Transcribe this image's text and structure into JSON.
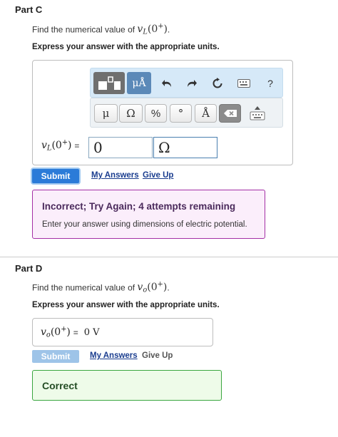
{
  "part_c": {
    "title": "Part C",
    "prompt": "Find the numerical value of",
    "var": "v",
    "var_sub": "L",
    "arg_open": "(0",
    "arg_sup": "+",
    "arg_close": ")",
    "period": ".",
    "instruction": "Express your answer with the appropriate units.",
    "toolbar": {
      "template_icon": "template-icon",
      "units_label": "μÅ",
      "undo_icon": "undo-icon",
      "redo_icon": "redo-icon",
      "reset_icon": "reset-icon",
      "keyboard_icon": "keyboard-icon",
      "help_label": "?"
    },
    "keys": [
      "μ",
      "Ω",
      "%",
      "°",
      "Å"
    ],
    "delete_icon": "backspace-icon",
    "keyboard_toggle_icon": "keyboard-toggle-icon",
    "label_equals": "=",
    "value_input": "0",
    "units_input": "Ω",
    "submit_label": "Submit",
    "my_answers": "My Answers",
    "give_up": "Give Up",
    "feedback_title": "Incorrect; Try Again; 4 attempts remaining",
    "feedback_body": "Enter your answer using dimensions of electric potential."
  },
  "part_d": {
    "title": "Part D",
    "prompt": "Find the numerical value of",
    "var": "v",
    "var_sub": "o",
    "arg_open": "(0",
    "arg_sup": "+",
    "arg_close": ")",
    "period": ".",
    "instruction": "Express your answer with the appropriate units.",
    "label_equals": "=",
    "answer_value": "0 V",
    "submit_label": "Submit",
    "my_answers": "My Answers",
    "give_up": "Give Up",
    "feedback_title": "Correct"
  },
  "colors": {
    "submit_active": "#2b7bd8",
    "submit_disabled": "#9ec4e8",
    "incorrect_border": "#a42fa6",
    "correct_border": "#3aa63f"
  }
}
